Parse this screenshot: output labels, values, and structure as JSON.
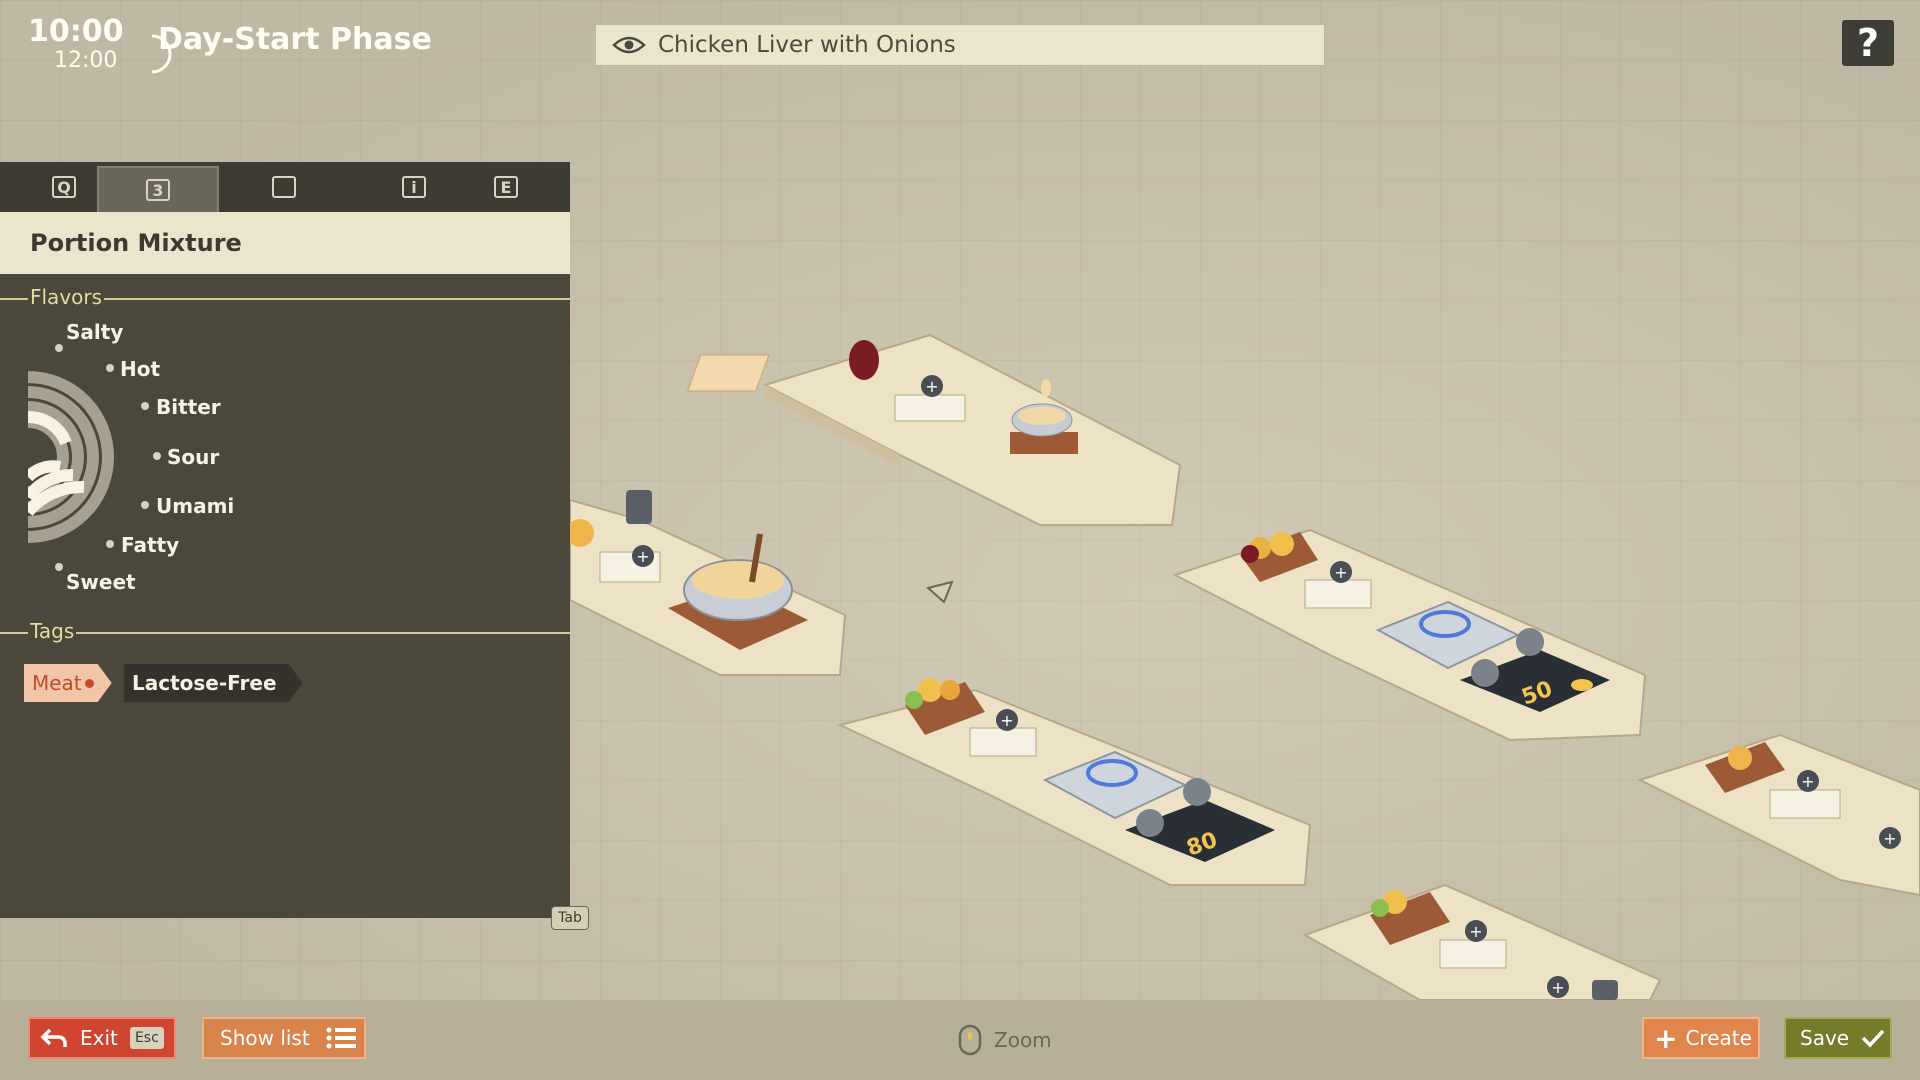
{
  "hud": {
    "time_current": "10:00",
    "time_end": "12:00",
    "phase": "Day-Start Phase"
  },
  "recipe": {
    "name": "Chicken Liver with Onions",
    "icon": "eye-icon"
  },
  "help": {
    "label": "?"
  },
  "panel": {
    "tabs": [
      {
        "icon": "search-icon",
        "label": "Q"
      },
      {
        "icon": "taste-icon",
        "label": "3",
        "active": true
      },
      {
        "icon": "recipe-card-icon",
        "label": ""
      },
      {
        "icon": "info-icon",
        "label": "i"
      },
      {
        "icon": "e-key-icon",
        "label": "E"
      }
    ],
    "title": "Portion Mixture",
    "flavors_label": "Flavors",
    "flavors": [
      "Salty",
      "Hot",
      "Bitter",
      "Sour",
      "Umami",
      "Fatty",
      "Sweet"
    ],
    "tags_label": "Tags",
    "tags": [
      "Meat",
      "Lactose-Free"
    ],
    "tab_key": "Tab"
  },
  "board": {
    "station_numbers": [
      "80",
      "50",
      "80"
    ],
    "stations": [
      {
        "id": "prep-1",
        "items": [
          "red-onion",
          "bowl-batter"
        ]
      },
      {
        "id": "prep-2",
        "items": [
          "onion",
          "mixing-bowl"
        ]
      },
      {
        "id": "stove-1",
        "items": [
          "veggies",
          "gas-stove"
        ]
      },
      {
        "id": "stove-2",
        "items": [
          "veggies",
          "gas-stove"
        ]
      },
      {
        "id": "prep-3",
        "items": [
          "onion"
        ]
      },
      {
        "id": "prep-4",
        "items": [
          "veggies"
        ]
      }
    ]
  },
  "bottom": {
    "exit_label": "Exit",
    "exit_key": "Esc",
    "show_list_label": "Show list",
    "zoom_label": "Zoom",
    "create_label": "Create",
    "save_label": "Save"
  },
  "colors": {
    "background": "#cbc3ad",
    "panel": "#4b483b",
    "exit": "#d0452f",
    "create": "#e0854c",
    "save": "#767a2b",
    "tag_meat": "#f2c4a8"
  }
}
